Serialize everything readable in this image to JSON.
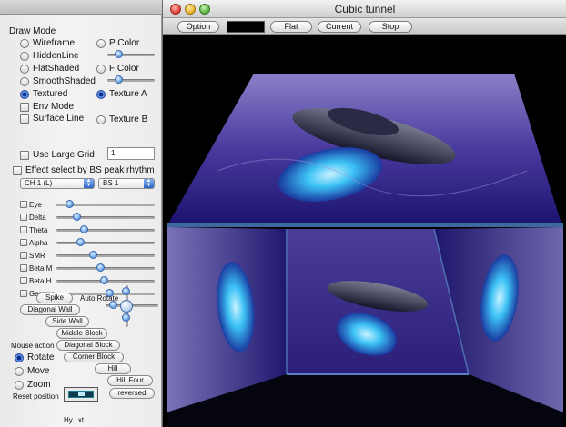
{
  "panel": {
    "draw_mode_label": "Draw Mode",
    "modes": [
      "Wireframe",
      "HiddenLine",
      "FlatShaded",
      "SmoothShaded",
      "Textured"
    ],
    "selected_mode": "Textured",
    "env_mode": "Env Mode",
    "surface_line": "Surface Line",
    "p_color": "P Color",
    "f_color": "F Color",
    "texture_a": "Texture A",
    "texture_b": "Texture B",
    "selected_texture": "Texture A",
    "use_large_grid": "Use Large Grid",
    "grid_value": "1",
    "effect_select": "Effect select by BS peak rhythm",
    "channel_select": "CH 1 (L)",
    "bs_select": "BS 1",
    "bands": [
      "Eye",
      "Delta",
      "Theta",
      "Alpha",
      "SMR",
      "Beta M",
      "Beta H",
      "Gamma"
    ],
    "band_levels": [
      0.1,
      0.18,
      0.26,
      0.22,
      0.36,
      0.44,
      0.48,
      0.55
    ],
    "auto_rotate": "Auto Rotate",
    "shape_buttons": [
      "Spike",
      "Diagonal Wall",
      "Side Wall",
      "Middle Block",
      "Diagonal Block",
      "Corner Block",
      "Hill",
      "Hill Four",
      "reversed"
    ],
    "mouse_action": "Mouse action",
    "mouse_modes": [
      "Rotate",
      "Move",
      "Zoom"
    ],
    "selected_mouse_mode": "Rotate",
    "reset_position": "Reset position",
    "bottom_label": "Hy...xt"
  },
  "window": {
    "title": "Cubic tunnel",
    "toolbar": {
      "option": "Option",
      "flat": "Flat",
      "current": "Current",
      "stop": "Stop",
      "color_swatch": "#000000"
    }
  },
  "colors": {
    "accent": "#2c62c9",
    "close": "#e0453a",
    "minimize": "#e9b32c",
    "zoom": "#58b43e",
    "scene_purple": "#3a2c8c",
    "glow": "#3cc2f5"
  }
}
